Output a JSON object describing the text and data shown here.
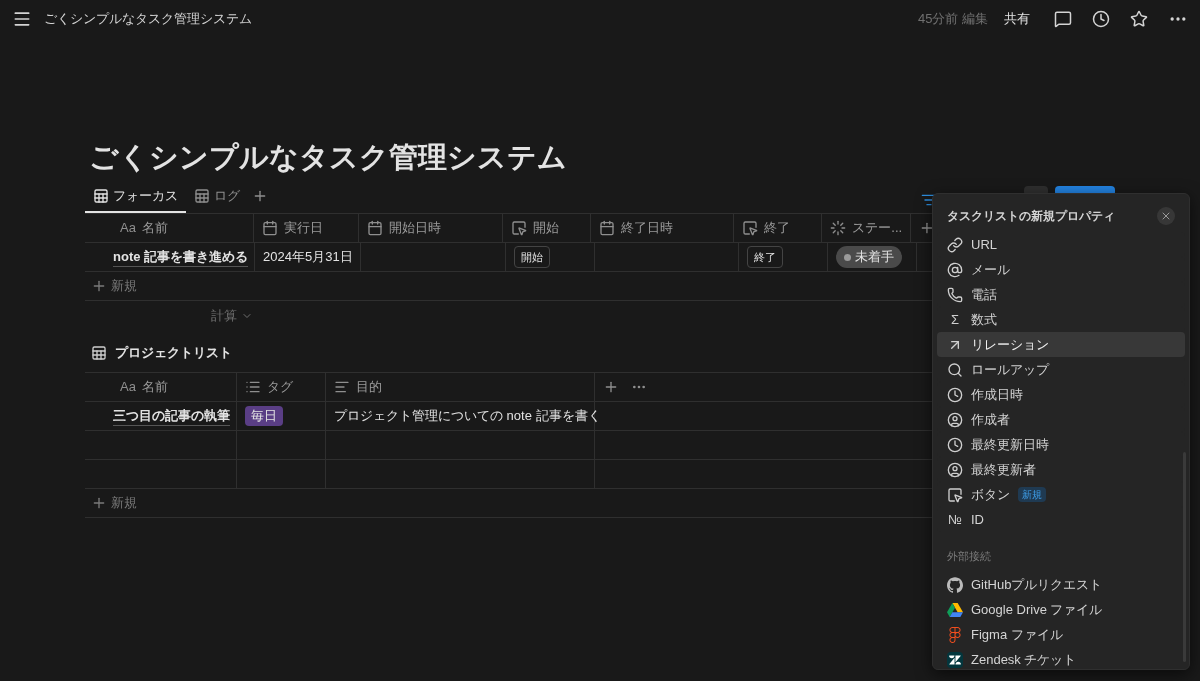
{
  "topbar": {
    "breadcrumb": "ごくシンプルなタスク管理システム",
    "edited": "45分前 編集",
    "share": "共有"
  },
  "title": "ごくシンプルなタスク管理システム",
  "views": [
    {
      "label": "フォーカス",
      "selected": true
    },
    {
      "label": "ログ",
      "selected": false
    }
  ],
  "task_table": {
    "columns": [
      {
        "kind": "title",
        "glyph": "Aa",
        "label": "名前"
      },
      {
        "kind": "date",
        "label": "実行日"
      },
      {
        "kind": "date",
        "label": "開始日時"
      },
      {
        "kind": "button",
        "label": "開始"
      },
      {
        "kind": "date",
        "label": "終了日時"
      },
      {
        "kind": "button",
        "label": "終了"
      },
      {
        "kind": "status",
        "label": "ステー..."
      }
    ],
    "rows": [
      {
        "name": "note 記事を書き進める",
        "date": "2024年5月31日",
        "start_button": "開始",
        "end_button": "終了",
        "status": "未着手"
      }
    ],
    "new_row": "新規",
    "calculate": "計算"
  },
  "project_list": {
    "title": "プロジェクトリスト",
    "columns": [
      {
        "kind": "title",
        "glyph": "Aa",
        "label": "名前"
      },
      {
        "kind": "select",
        "label": "タグ"
      },
      {
        "kind": "text",
        "label": "目的"
      }
    ],
    "rows": [
      {
        "name": "三つ目の記事の執筆",
        "tag": {
          "label": "毎日",
          "color": "#5a3e85"
        },
        "purpose": "プロジェクト管理についての note 記事を書く"
      }
    ],
    "new_row": "新規"
  },
  "property_menu": {
    "title": "タスクリストの新規プロパティ",
    "items": [
      {
        "kind": "url",
        "label": "URL",
        "selected": false
      },
      {
        "kind": "email",
        "label": "メール",
        "selected": false
      },
      {
        "kind": "phone",
        "label": "電話",
        "selected": false
      },
      {
        "kind": "formula",
        "glyph": "Σ",
        "label": "数式",
        "selected": false
      },
      {
        "kind": "relation",
        "label": "リレーション",
        "selected": true
      },
      {
        "kind": "rollup",
        "label": "ロールアップ",
        "selected": false
      },
      {
        "kind": "created_time",
        "label": "作成日時",
        "selected": false
      },
      {
        "kind": "created_by",
        "label": "作成者",
        "selected": false
      },
      {
        "kind": "last_edited_time",
        "label": "最終更新日時",
        "selected": false
      },
      {
        "kind": "last_edited_by",
        "label": "最終更新者",
        "selected": false
      },
      {
        "kind": "button",
        "label": "ボタン",
        "badge": "新規",
        "selected": false
      },
      {
        "kind": "id",
        "glyph": "№",
        "label": "ID",
        "selected": false
      }
    ],
    "section": "外部接続",
    "connections": [
      {
        "kind": "github",
        "label": "GitHubプルリクエスト"
      },
      {
        "kind": "drive",
        "label": "Google Drive ファイル"
      },
      {
        "kind": "figma",
        "label": "Figma ファイル"
      },
      {
        "kind": "zendesk",
        "label": "Zendesk チケット"
      }
    ]
  }
}
